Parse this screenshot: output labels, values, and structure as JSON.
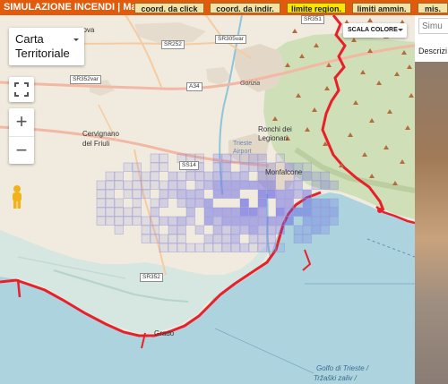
{
  "header": {
    "title": "SIMULAZIONE INCENDI | Main",
    "buttons": [
      {
        "label": "coord. da click",
        "active": false
      },
      {
        "label": "coord. da indir.",
        "active": false
      },
      {
        "label": "limite region.",
        "active": true
      },
      {
        "label": "limiti ammin.",
        "active": false
      },
      {
        "label": "mis.",
        "active": false
      }
    ]
  },
  "map": {
    "map_type_label_line1": "Carta",
    "map_type_label_line2": "Territoriale",
    "zoom_in": "+",
    "zoom_out": "−",
    "color_scale_select": "SCALA COLORE",
    "place_labels": {
      "nova": "nova",
      "gorizia": "Gorizia",
      "ronchi1": "Ronchi dei",
      "ronchi2": "Legionari",
      "airport1": "Trieste",
      "airport2": "Airport",
      "cervignano1": "Cervignano",
      "cervignano2": "del Friuli",
      "monfalcone": "Monfalcone",
      "grado": "Grado",
      "golfo1": "Golfo di Trieste /",
      "golfo2": "Tržaški zaliv /"
    },
    "road_labels": {
      "sr351": "SR351",
      "sr252": "SR252",
      "sr305var": "SR305var",
      "sr352var": "SR352var",
      "a34": "A34",
      "ss14": "SS14",
      "sr352": "SR352"
    }
  },
  "side_panel": {
    "search_placeholder": "Simu",
    "description_label": "Descrizi"
  },
  "colors": {
    "header_bg": "#e25a0c",
    "active_button": "#f6e600",
    "region_border": "#e8202a",
    "fire_cells": "#5a5ae6"
  },
  "fire_density": [
    {
      "density": 0.1
    },
    {
      "density": 0.2
    },
    {
      "density": 0.3
    },
    {
      "density": 0.45
    },
    {
      "density": 0.6
    }
  ]
}
